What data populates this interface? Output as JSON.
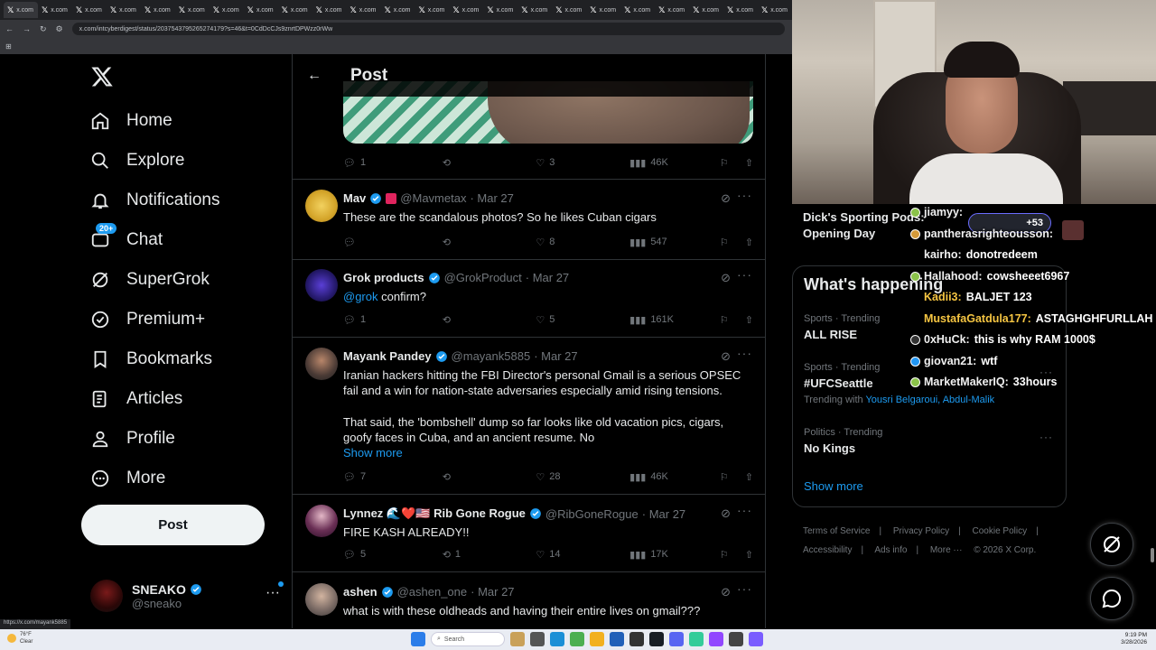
{
  "browser": {
    "tabs": [
      "x.com",
      "x.com",
      "x.com",
      "x.com",
      "x.com",
      "x.com",
      "x.com",
      "x.com",
      "x.com",
      "x.com",
      "x.com",
      "x.com",
      "x.com",
      "x.com",
      "x.com",
      "x.com",
      "x.com",
      "x.com",
      "x.com",
      "x.com",
      "x.com",
      "x.com",
      "x.com"
    ],
    "url": "x.com/intcyberdigest/status/2037543795265274179?s=46&t=0CdDcCJs9znrtDPWzz0rWw",
    "status_url": "https://x.com/mayank5885"
  },
  "sidebar": {
    "items": [
      {
        "label": "Home",
        "icon": "home-icon"
      },
      {
        "label": "Explore",
        "icon": "search-icon"
      },
      {
        "label": "Notifications",
        "icon": "bell-icon"
      },
      {
        "label": "Chat",
        "icon": "chat-icon",
        "badge": "20+"
      },
      {
        "label": "SuperGrok",
        "icon": "grok-icon"
      },
      {
        "label": "Premium+",
        "icon": "premium-icon"
      },
      {
        "label": "Bookmarks",
        "icon": "bookmark-icon"
      },
      {
        "label": "Articles",
        "icon": "article-icon"
      },
      {
        "label": "Profile",
        "icon": "person-icon"
      },
      {
        "label": "More",
        "icon": "more-circle-icon"
      }
    ],
    "post_button": "Post",
    "account": {
      "name": "SNEAKO",
      "handle": "@sneako"
    }
  },
  "header": {
    "title": "Post"
  },
  "top_post_actions": {
    "replies": "1",
    "reposts": "",
    "likes": "3",
    "views": "46K"
  },
  "replies": [
    {
      "name": "Mav",
      "handle": "@Mavmetax",
      "date": "· Mar 27",
      "text": "These are the scandalous photos? So he likes Cuban cigars",
      "replies": "",
      "reposts": "",
      "likes": "8",
      "views": "547"
    },
    {
      "name": "Grok products",
      "handle": "@GrokProduct",
      "date": "· Mar 27",
      "mention": "@grok",
      "text": " confirm?",
      "replies": "1",
      "reposts": "",
      "likes": "5",
      "views": "161K"
    },
    {
      "name": "Mayank Pandey",
      "handle": "@mayank5885",
      "date": "· Mar 27",
      "text": "Iranian hackers hitting the FBI Director's personal Gmail is a serious OPSEC fail and a win for nation-state adversaries especially amid rising tensions.",
      "text2": "That said, the 'bombshell' dump so far looks like old vacation pics, cigars, goofy faces in Cuba, and an ancient resume. No",
      "show_more": "Show more",
      "replies": "7",
      "reposts": "",
      "likes": "28",
      "views": "46K"
    },
    {
      "name": "Lynnez 🌊❤️🇺🇸 Rib Gone Rogue",
      "handle": "@RibGoneRogue",
      "date": "· Mar 27",
      "text": "FIRE KASH ALREADY!!",
      "replies": "5",
      "reposts": "1",
      "likes": "14",
      "views": "17K"
    },
    {
      "name": "ashen",
      "handle": "@ashen_one",
      "date": "· Mar 27",
      "text": "what is with these oldheads and having their entire lives on gmail???"
    }
  ],
  "right": {
    "top_trend": "Dick's Sporting Pods: Opening Day",
    "happening_title": "What's happening",
    "trends": [
      {
        "category": "Sports · Trending",
        "title": "ALL RISE"
      },
      {
        "category": "Sports · Trending",
        "title": "#UFCSeattle",
        "with_label": "Trending with",
        "with": "Yousri Belgaroui, Abdul-Malik"
      },
      {
        "category": "Politics · Trending",
        "title": "No Kings"
      }
    ],
    "show_more": "Show more",
    "footer": [
      "Terms of Service",
      "|",
      "Privacy Policy",
      "|",
      "Cookie Policy",
      "|",
      "Accessibility",
      "|",
      "Ads info",
      "|",
      "More ···",
      "© 2026 X Corp."
    ]
  },
  "stream_chat": {
    "plus_count": "+53",
    "messages": [
      {
        "user": "jiamyy:",
        "text": "",
        "color": "#f0f0f0"
      },
      {
        "user": "pantherasrighteousson:",
        "text": "",
        "color": "#f0f0f0"
      },
      {
        "user": "kairho:",
        "text": "donotredeem",
        "color": "#f0f0f0"
      },
      {
        "user": "Hallahood:",
        "text": "cowsheeet6967",
        "color": "#f0f0f0"
      },
      {
        "user": "Kadii3:",
        "text": "BALJET 123",
        "color": "#f5c542"
      },
      {
        "user": "MustafaGatdula177:",
        "text": "ASTAGHGHFURLLAH",
        "color": "#f5c542"
      },
      {
        "user": "0xHuCk:",
        "text": "this is why RAM 1000$",
        "color": "#f0f0f0"
      },
      {
        "user": "giovan21:",
        "text": "wtf",
        "color": "#f0f0f0"
      },
      {
        "user": "MarketMakerIQ:",
        "text": "33hours",
        "color": "#f0f0f0"
      }
    ]
  },
  "taskbar": {
    "weather_temp": "76°F",
    "weather_desc": "Clear",
    "search": "Search",
    "time": "9:19 PM",
    "date": "3/28/2026"
  },
  "colors": {
    "accent": "#1d9bf0",
    "bg": "#000000",
    "border": "#2f3336",
    "muted": "#71767b"
  }
}
